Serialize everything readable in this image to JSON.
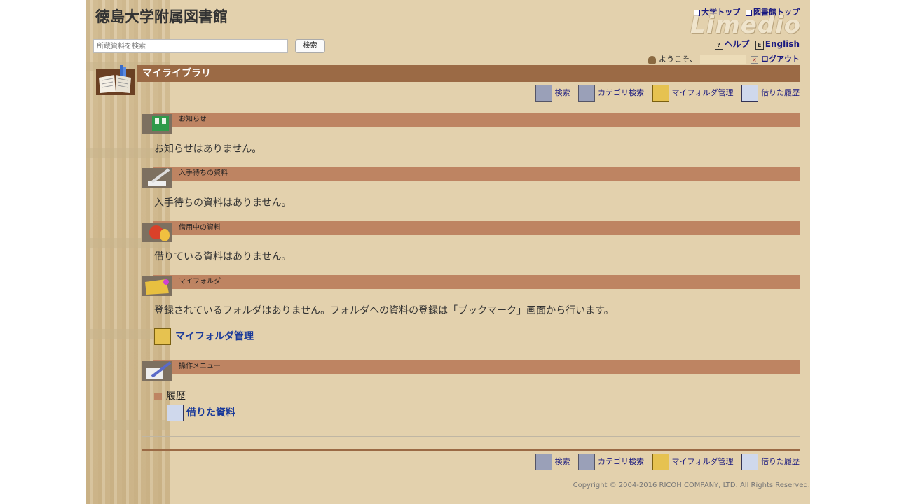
{
  "header": {
    "title": "徳島大学附属図書館",
    "search_placeholder": "所蔵資料を検索",
    "search_button": "検索",
    "links": {
      "univ_top": "大学トップ",
      "lib_top": "図書館トップ"
    },
    "logo_text": "Limedio",
    "help": "ヘルプ",
    "english": "English",
    "welcome": "ようこそ、",
    "logout": "ログアウト"
  },
  "main": {
    "title": "マイライブラリ",
    "nav": [
      "検索",
      "カテゴリ検索",
      "マイフォルダ管理",
      "借りた履歴"
    ],
    "sections": {
      "notice": {
        "label": "お知らせ",
        "message": "お知らせはありません。"
      },
      "waiting": {
        "label": "入手待ちの資料",
        "message": "入手待ちの資料はありません。"
      },
      "borrowing": {
        "label": "借用中の資料",
        "message": "借りている資料はありません。"
      },
      "myfolder": {
        "label": "マイフォルダ",
        "message": "登録されているフォルダはありません。フォルダへの資料の登録は「ブックマーク」画面から行います。",
        "link": "マイフォルダ管理"
      },
      "menu": {
        "label": "操作メニュー",
        "history_label": "履歴",
        "borrowed_link": "借りた資料"
      }
    }
  },
  "footer": {
    "nav": [
      "検索",
      "カテゴリ検索",
      "マイフォルダ管理",
      "借りた履歴"
    ],
    "copyright": "Copyright © 2004-2016 RICOH COMPANY, LTD. All Rights Reserved."
  }
}
